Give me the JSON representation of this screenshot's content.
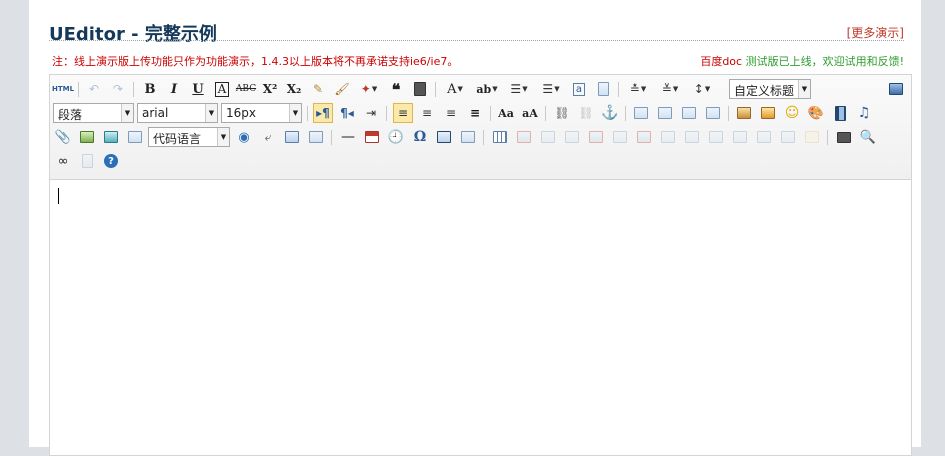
{
  "page": {
    "title": "UEditor - 完整示例",
    "more_link": "[更多演示]",
    "notice": "注：线上演示版上传功能只作为功能演示，1.4.3以上版本将不再承诺支持ie6/ie7。",
    "doc_line_red": "百度doc",
    "doc_line_green": " 测试版已上线，欢迎试用和反馈!"
  },
  "toolbar": {
    "source_label": "HTML",
    "paragraph_select": "段落",
    "font_select": "arial",
    "size_select": "16px",
    "custom_title_select": "自定义标题",
    "code_lang_select": "代码语言",
    "bold": "B",
    "italic": "I",
    "underline": "U",
    "fontborder": "A",
    "strike": "ABC",
    "superscript": "X²",
    "subscript": "X₂",
    "blockquote": "❝",
    "forecolor": "A",
    "backcolor": "ab",
    "omega": "Ω",
    "format_a": "Aa",
    "anchor": "⚓",
    "hr": "—",
    "help": "?"
  },
  "colors": {
    "title": "#14395a",
    "notice": "#cc0000",
    "green": "#2e9e2e",
    "page_bg": "#dde1e5",
    "selected_button_bg": "#fbe9a9"
  }
}
